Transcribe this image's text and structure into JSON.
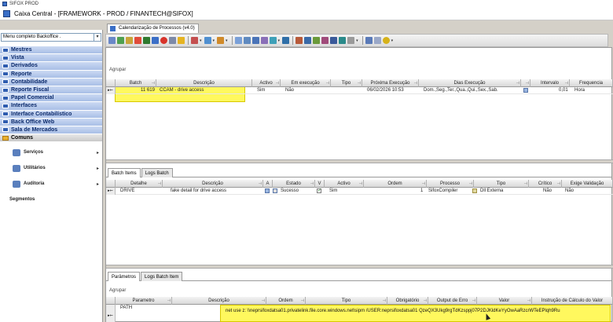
{
  "outer_window": {
    "title": "SIFOX PROD"
  },
  "app": {
    "title": "Caixa Central - [FRAMEWORK - PROD / FINANTECH@SIFOX]"
  },
  "left_panel": {
    "menu_select": "Menu completo Backoffice .",
    "items": [
      {
        "label": "Mestres"
      },
      {
        "label": "Vista"
      },
      {
        "label": "Derivados"
      },
      {
        "label": "Reporte"
      },
      {
        "label": "Contabilidade"
      },
      {
        "label": "Reporte Fiscal"
      },
      {
        "label": "Papel Comercial"
      },
      {
        "label": "Interfaces"
      },
      {
        "label": "Interface Contabilístico"
      },
      {
        "label": "Back Office Web"
      },
      {
        "label": "Sala de Mercados"
      },
      {
        "label": "Comuns"
      }
    ],
    "sub_items": [
      {
        "label": "Serviços",
        "chevron": "▸"
      },
      {
        "label": "Utilitários",
        "chevron": "▸"
      },
      {
        "label": "Auditoria",
        "chevron": "▸"
      },
      {
        "label": "Segmentos",
        "chevron": ""
      }
    ]
  },
  "main": {
    "tab_label": "Calendarização de Processos (v4.0)",
    "group_label_1": "Agrupar",
    "grid1": {
      "headers": [
        "Batch",
        "Descrição",
        "Activo",
        "Em execução",
        "Tipo",
        "Próxima Execução",
        "Dias Execução",
        "Intervalo",
        "Frequencia"
      ],
      "row": {
        "batch": "11 619",
        "descricao": "CCAM - drive access",
        "activo": "Sim",
        "em_execucao": "Não",
        "proxima": "06/02/2026 10:53",
        "dias": "Dom.,Seg.,Ter.,Qua.,Qui.,Sex.,Sab.",
        "intervalo": "0,01",
        "frequencia": "Hora"
      }
    },
    "subtabs_1": [
      "Batch Items",
      "Logs Batch"
    ],
    "grid2": {
      "headers": [
        "Detalhe",
        "Descrição",
        "A",
        "Estado",
        "V",
        "Activo",
        "Ordem",
        "Processo",
        "Tipo",
        "Crítico",
        "Exige Validação"
      ],
      "row": {
        "detalhe": "DRIVE",
        "descricao": "fake detail for drive access",
        "estado": "Sucesso",
        "activo": "Sim",
        "ordem": "1",
        "processo": "SifoxCompiler",
        "tipo": "Dll Externa",
        "critico": "Não",
        "exige": "Não"
      }
    },
    "subtabs_2": [
      "Parâmetros",
      "Logs Batch Item"
    ],
    "group_label_2": "Agrupar",
    "grid3": {
      "headers": [
        "Parametro",
        "Descrição",
        "Ordem",
        "Tipo",
        "Obrigatório",
        "Output de Erro",
        "Valor",
        "Instrução de Cálculo do Valor"
      ],
      "row": {
        "parametro": "PATH",
        "valor": "net use z: \\\\neprsifoxdatsa01.privatelink.file.core.windows.net\\sipm /USER:neprsifoxdatsa01 QzeQX3Ukg9rgTdKzsppj07P2DJKldKeYyOwAaRzcrWTeEPlqh9Ru"
      }
    }
  },
  "colors": {
    "highlight": "#fff528",
    "menu_bg": "#a9bfe6",
    "menu_text": "#0b2a6b"
  }
}
